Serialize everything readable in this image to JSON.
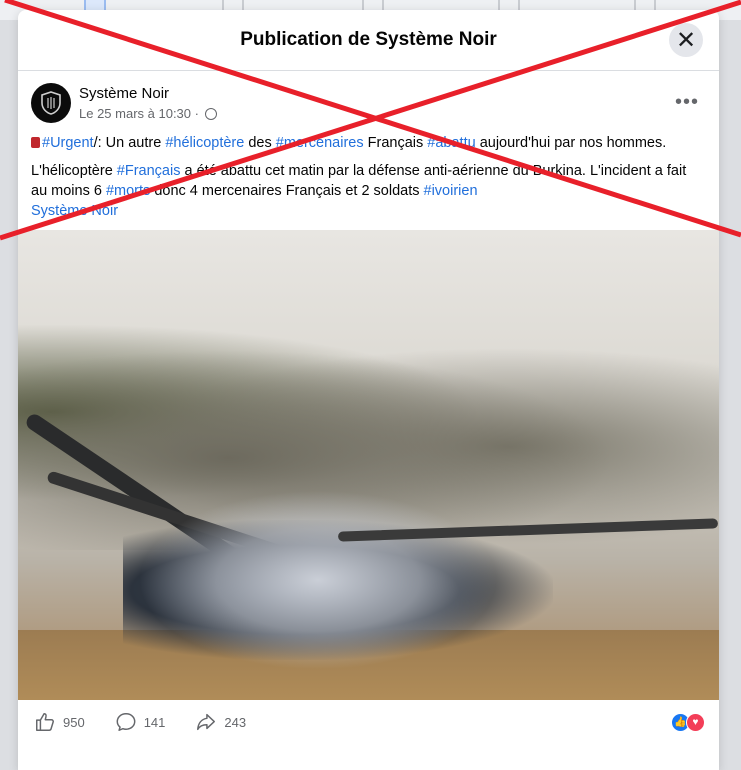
{
  "dialog": {
    "title": "Publication de Système Noir",
    "close_label": "✕"
  },
  "post": {
    "author": "Système Noir",
    "timestamp": "Le 25 mars à 10:30 ·",
    "more_label": "•••",
    "line1": {
      "tag_urgent": "#Urgent",
      "t1": "/: Un autre ",
      "tag_helicoptere": "#hélicoptère",
      "t2": " des ",
      "tag_mercenaires": "#mercenaires",
      "t3": " Français ",
      "tag_abattu": "#abattu",
      "t4": " aujourd'hui par nos hommes."
    },
    "line2": {
      "t1": " L'hélicoptère ",
      "tag_francais": "#Français",
      "t2": " a été abattu cet matin par la défense anti-aérienne du Burkina. L'incident a fait au moins 6 ",
      "tag_morts": "#morts",
      "t3": " donc 4 mercenaires Français et 2 soldats ",
      "tag_ivoirien": "#ivoirien"
    },
    "page_link": "Système Noir"
  },
  "engagement": {
    "likes": "950",
    "comments": "141",
    "shares": "243"
  },
  "colors": {
    "hashtag": "#216fdb",
    "cross": "#e8202a",
    "like": "#1877f2",
    "love": "#f33e58"
  },
  "icons": [
    "shield-icon",
    "globe-icon",
    "like-icon",
    "comment-icon",
    "share-icon",
    "flag-icon",
    "close-icon",
    "more-icon"
  ]
}
